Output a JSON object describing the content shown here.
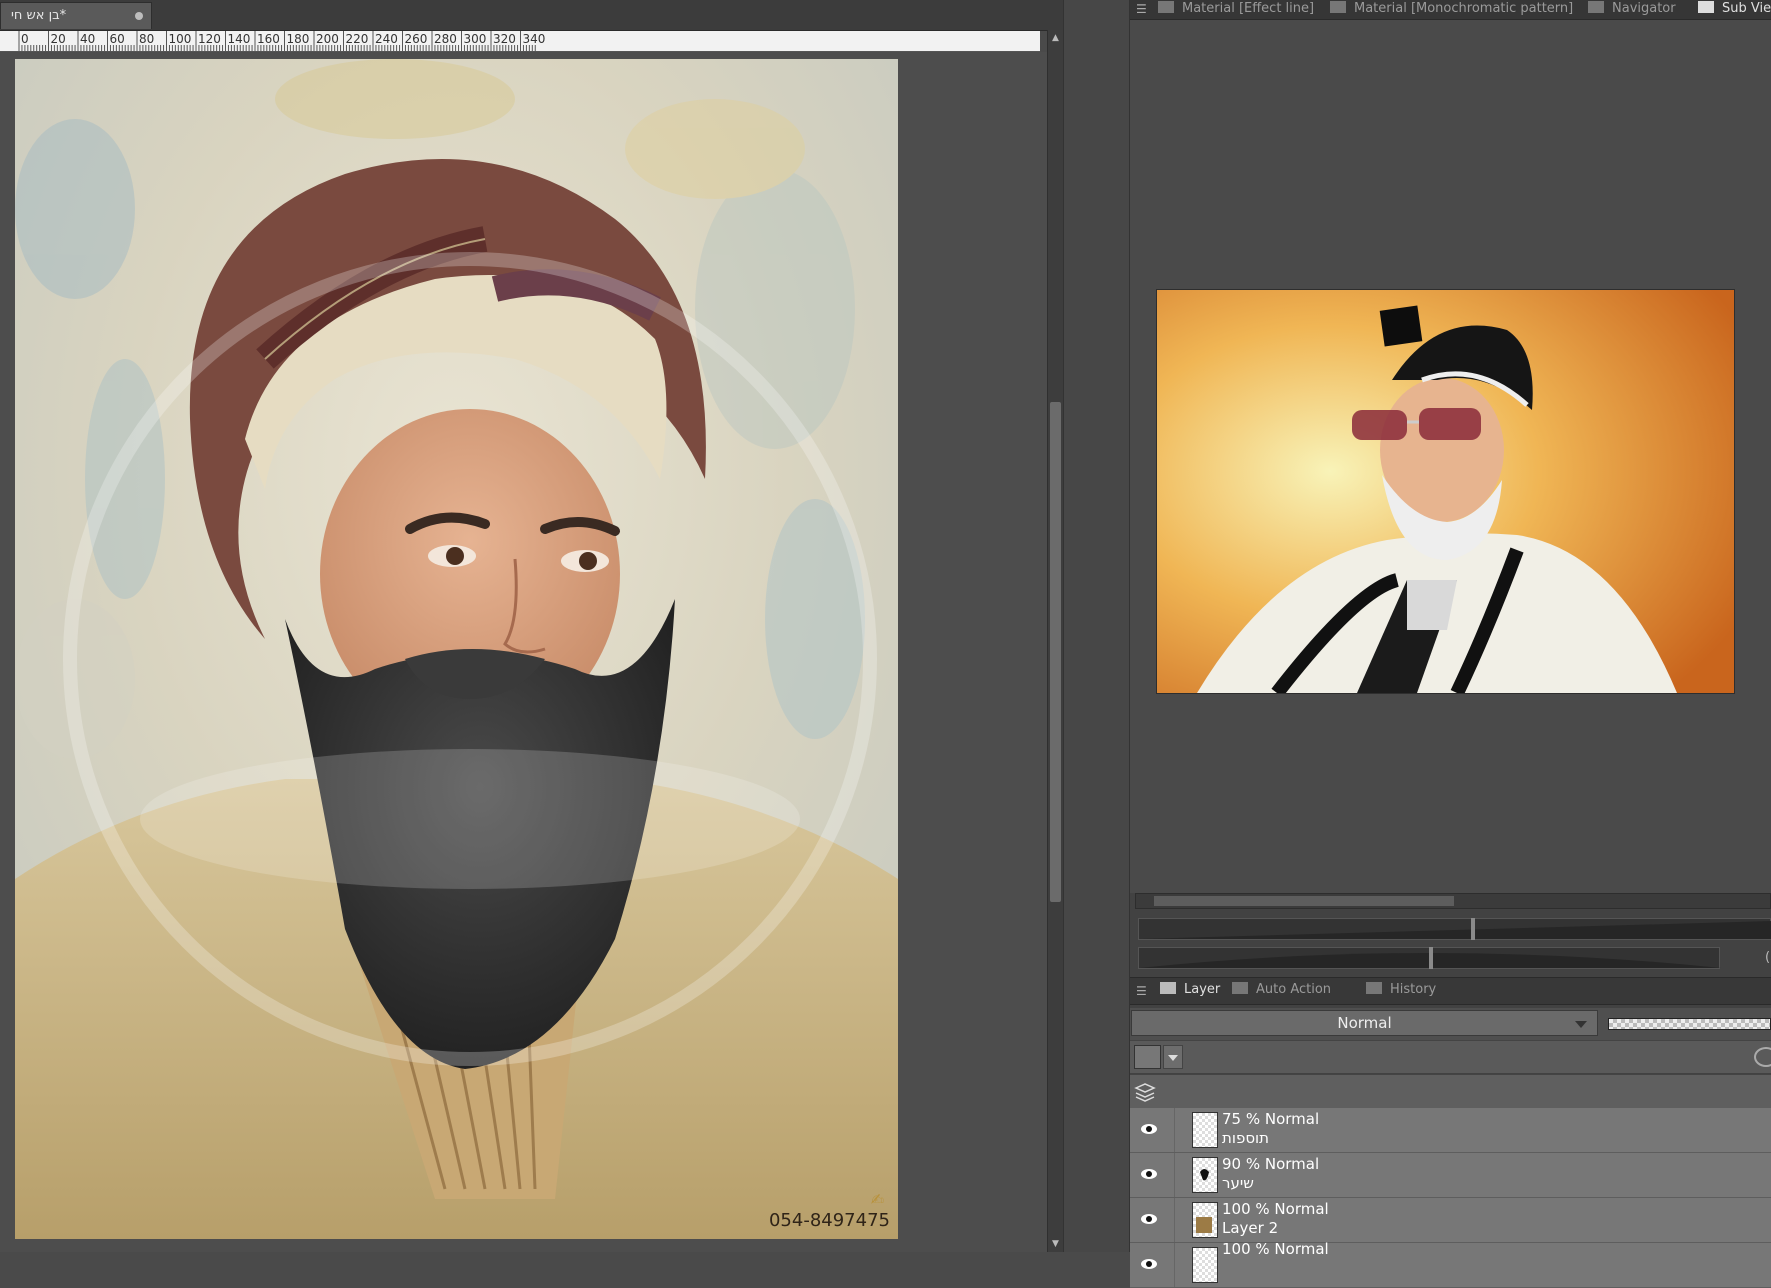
{
  "document": {
    "tab_title": "*בן אש חי",
    "ruler_labels": [
      "0",
      "20",
      "40",
      "60",
      "80",
      "100",
      "120",
      "140",
      "160",
      "180",
      "200",
      "220",
      "240",
      "260",
      "280",
      "300",
      "320",
      "340"
    ],
    "phone_watermark": "054-8497475"
  },
  "panels": {
    "top_tabs": [
      {
        "label": "Material [Effect line]",
        "icon": "material-icon"
      },
      {
        "label": "Material [Monochromatic pattern]",
        "icon": "pattern-icon"
      },
      {
        "label": "Navigator",
        "icon": "navigator-icon"
      },
      {
        "label": "Sub View",
        "icon": "subview-icon"
      }
    ],
    "subview": {
      "rotation_value_partial": "("
    },
    "layer_tabs": [
      {
        "label": "Layer",
        "icon": "layer-icon"
      },
      {
        "label": "Auto Action",
        "icon": "auto-action-icon"
      },
      {
        "label": "History",
        "icon": "history-icon"
      }
    ],
    "blend_mode": "Normal",
    "layers": [
      {
        "opacity_mode": "75 % Normal",
        "name": "תוספות",
        "visible": true
      },
      {
        "opacity_mode": "90 % Normal",
        "name": "שיער",
        "visible": true
      },
      {
        "opacity_mode": "100 % Normal",
        "name": "Layer 2",
        "visible": true
      },
      {
        "opacity_mode": "100 % Normal",
        "name": "",
        "visible": true
      }
    ]
  },
  "colors": {
    "ui_dark": "#3c3c3c",
    "ui_mid": "#4a4a4a",
    "ui_panel": "#424242",
    "layer_row": "#777777"
  }
}
